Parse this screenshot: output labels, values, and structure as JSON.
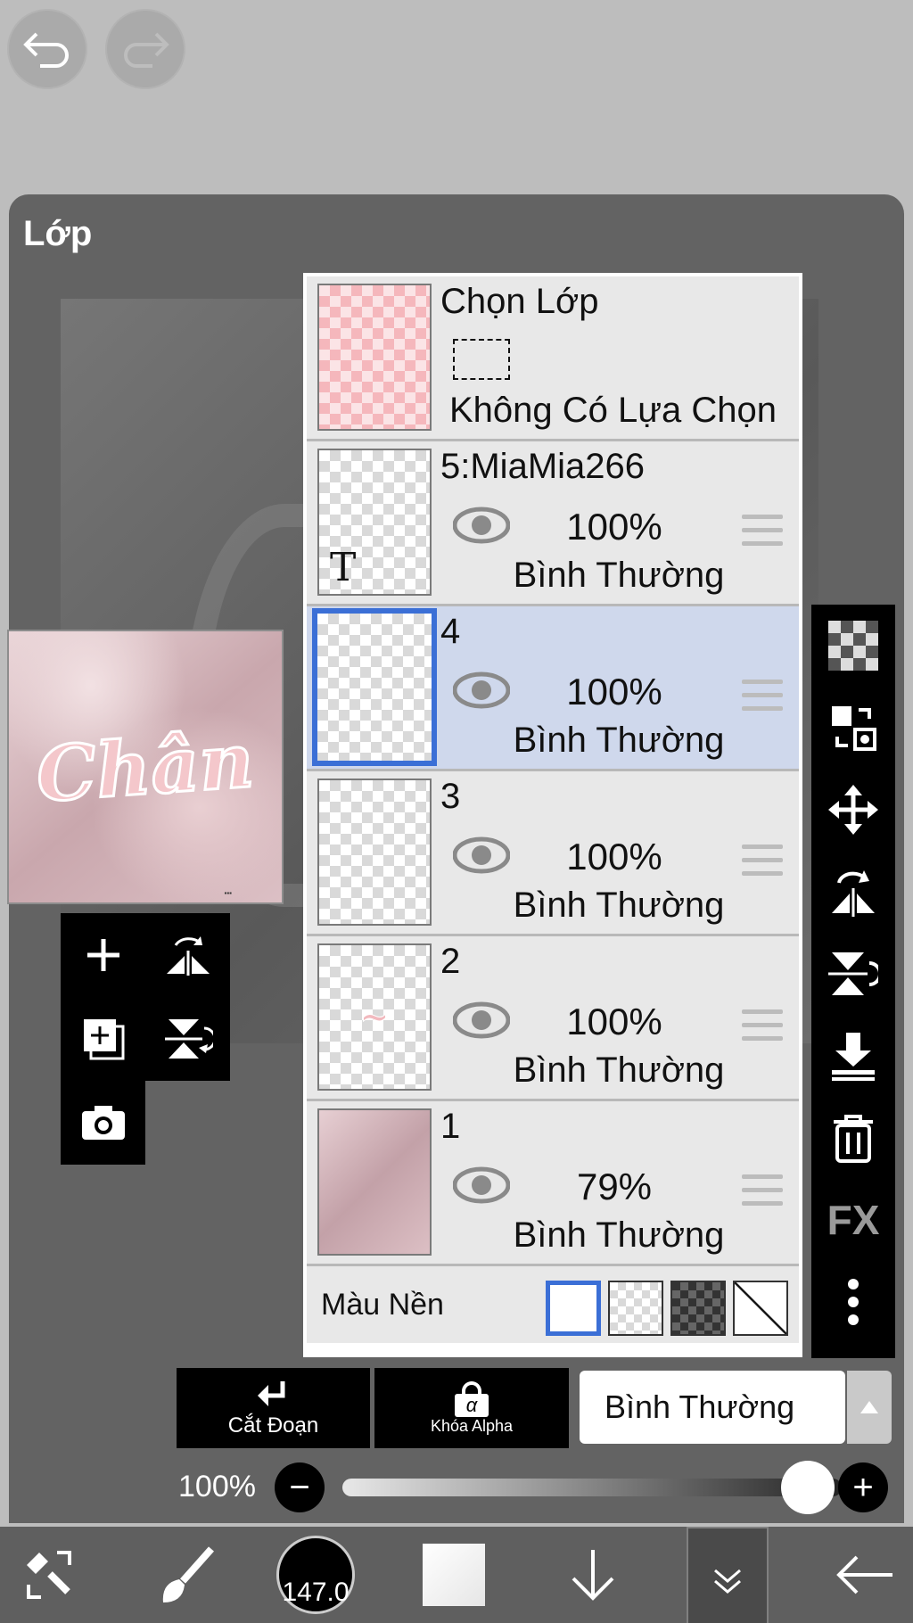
{
  "panel": {
    "title": "Lớp"
  },
  "selection_layer": {
    "name": "Chọn Lớp",
    "status": "Không Có Lựa Chọn"
  },
  "layers": [
    {
      "name": "5:MiaMia266",
      "opacity": "100%",
      "blend": "Bình Thường",
      "type_badge": "T",
      "selected": false
    },
    {
      "name": "4",
      "opacity": "100%",
      "blend": "Bình Thường",
      "selected": true
    },
    {
      "name": "3",
      "opacity": "100%",
      "blend": "Bình Thường",
      "selected": false
    },
    {
      "name": "2",
      "opacity": "100%",
      "blend": "Bình Thường",
      "selected": false
    },
    {
      "name": "1",
      "opacity": "79%",
      "blend": "Bình Thường",
      "selected": false
    }
  ],
  "background_color": {
    "label": "Màu Nền"
  },
  "canvas_preview": {
    "text": "Chân"
  },
  "actions": {
    "clip_label": "Cắt Đoạn",
    "alpha_lock_label": "Khóa Alpha",
    "alpha_symbol": "α",
    "fx_label": "FX"
  },
  "blend_mode": {
    "selected": "Bình Thường"
  },
  "opacity": {
    "value": "100%",
    "minus": "−",
    "plus": "+"
  },
  "brush": {
    "size": "147.0"
  },
  "colors": {
    "selection_blue": "#3b6fd6",
    "selected_row": "#cfd8ec",
    "panel": "#636363"
  },
  "icons": [
    "undo-icon",
    "redo-icon",
    "add-layer-icon",
    "flip-icon",
    "copy-layer-icon",
    "merge-icon",
    "camera-icon",
    "checker-icon",
    "transform-icon",
    "move-icon",
    "rotate-flip-icon",
    "flip-vertical-icon",
    "merge-down-icon",
    "trash-icon",
    "more-icon",
    "brush-icon",
    "arrow-down-icon",
    "collapse-icon",
    "back-icon"
  ]
}
